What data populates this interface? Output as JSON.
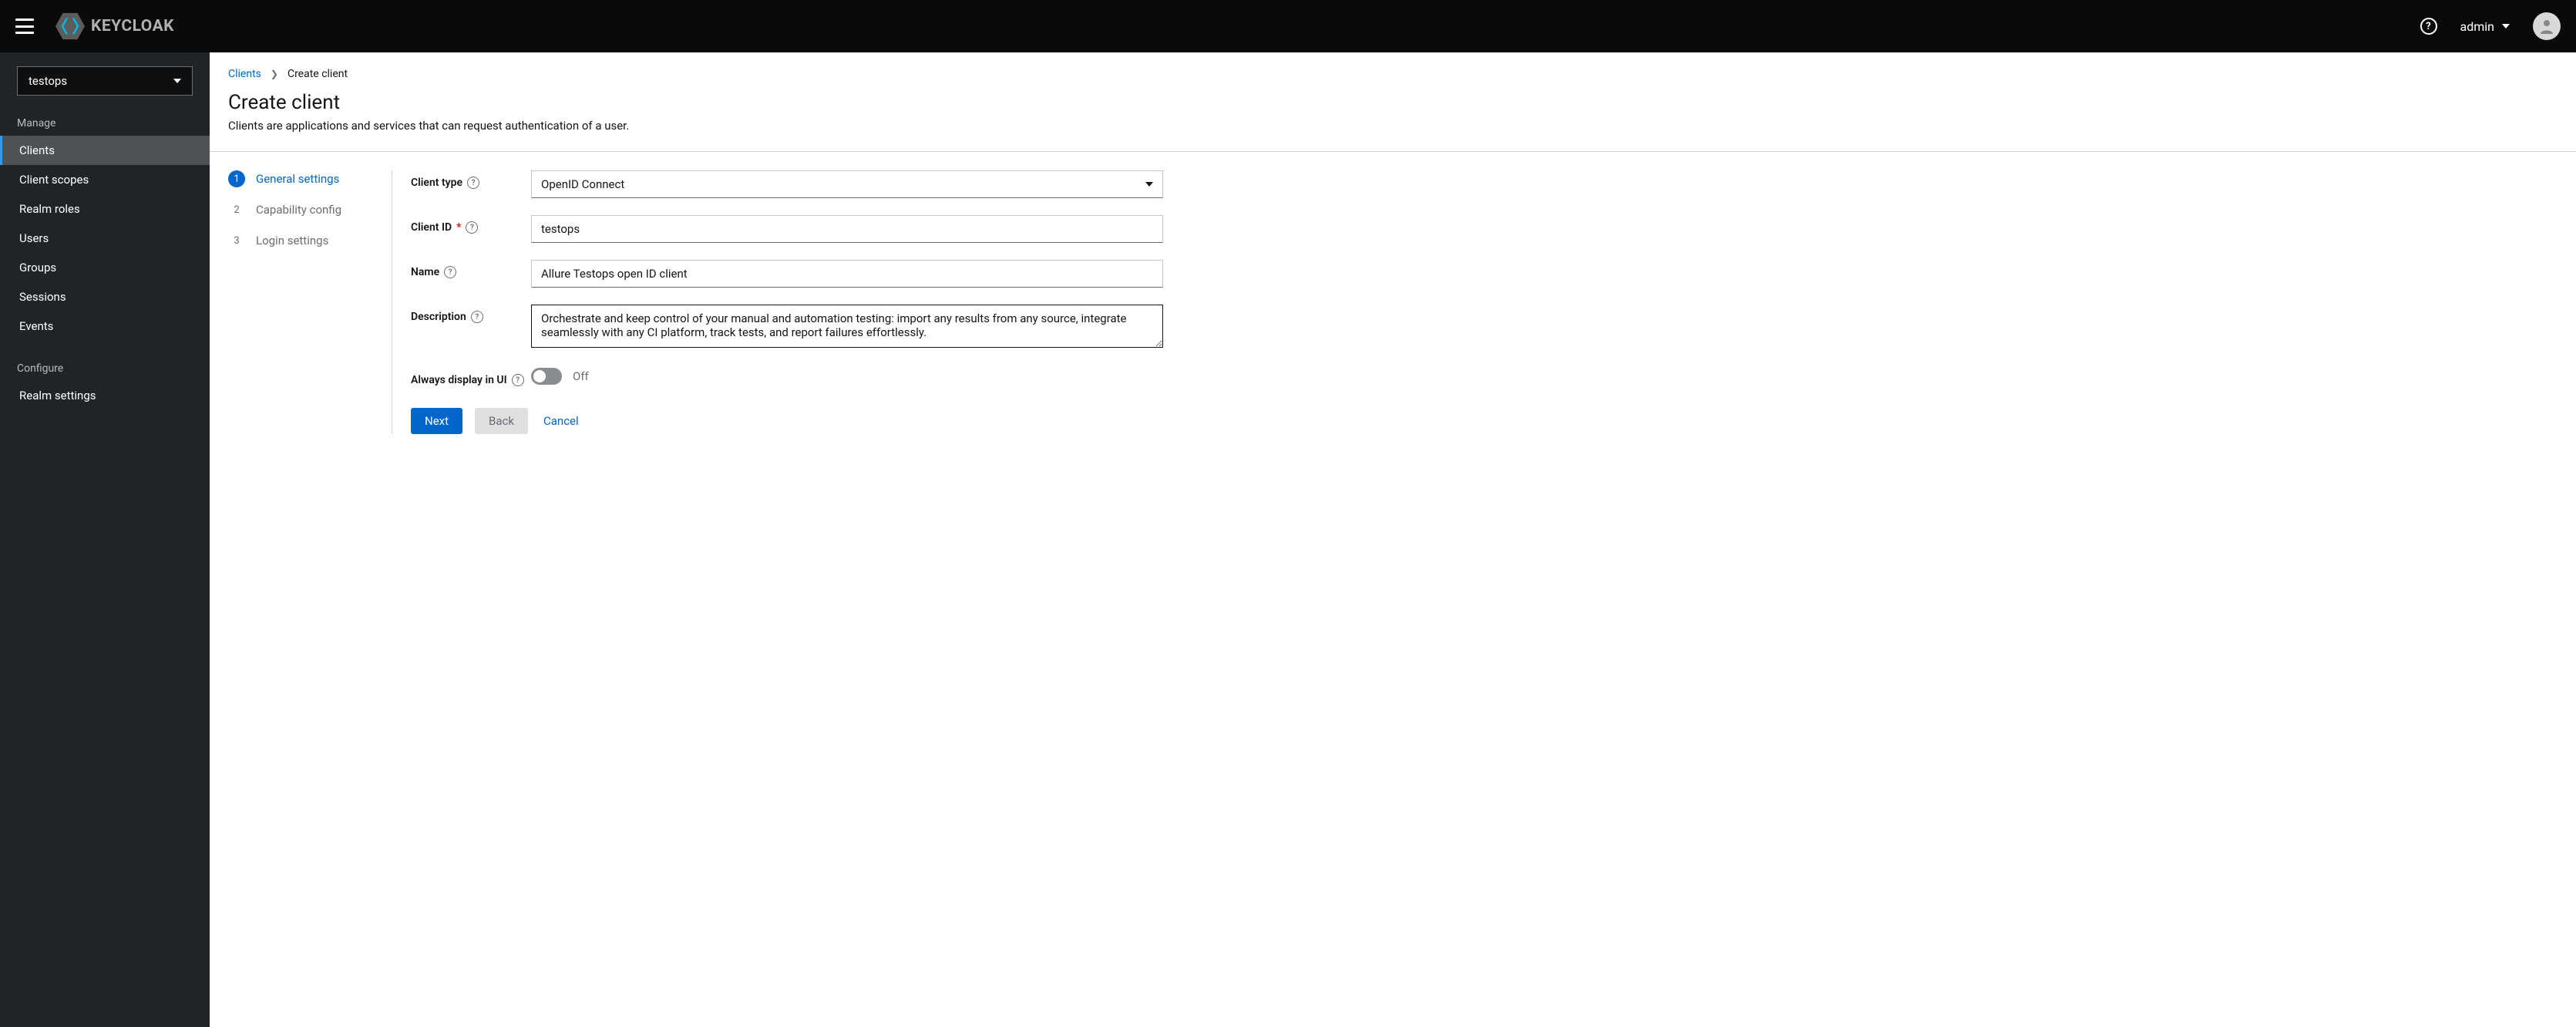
{
  "header": {
    "brand": "KEYCLOAK",
    "help_icon": "?",
    "user": "admin"
  },
  "sidebar": {
    "realm_selected": "testops",
    "sections": {
      "manage_label": "Manage",
      "configure_label": "Configure"
    },
    "items_manage": [
      {
        "label": "Clients",
        "active": true
      },
      {
        "label": "Client scopes",
        "active": false
      },
      {
        "label": "Realm roles",
        "active": false
      },
      {
        "label": "Users",
        "active": false
      },
      {
        "label": "Groups",
        "active": false
      },
      {
        "label": "Sessions",
        "active": false
      },
      {
        "label": "Events",
        "active": false
      }
    ],
    "items_configure": [
      {
        "label": "Realm settings",
        "active": false
      }
    ]
  },
  "breadcrumb": {
    "parent": "Clients",
    "current": "Create client"
  },
  "page": {
    "title": "Create client",
    "description": "Clients are applications and services that can request authentication of a user."
  },
  "wizard": {
    "steps": [
      {
        "num": "1",
        "label": "General settings",
        "active": true
      },
      {
        "num": "2",
        "label": "Capability config",
        "active": false
      },
      {
        "num": "3",
        "label": "Login settings",
        "active": false
      }
    ]
  },
  "form": {
    "client_type_label": "Client type",
    "client_type_value": "OpenID Connect",
    "client_id_label": "Client ID",
    "client_id_value": "testops",
    "name_label": "Name",
    "name_value": "Allure Testops open ID client",
    "description_label": "Description",
    "description_value": "Orchestrate and keep control of your manual and automation testing: import any results from any source, integrate seamlessly with any CI platform, track tests, and report failures effortlessly.",
    "always_display_label": "Always display in UI",
    "always_display_state": "Off"
  },
  "buttons": {
    "next": "Next",
    "back": "Back",
    "cancel": "Cancel"
  }
}
